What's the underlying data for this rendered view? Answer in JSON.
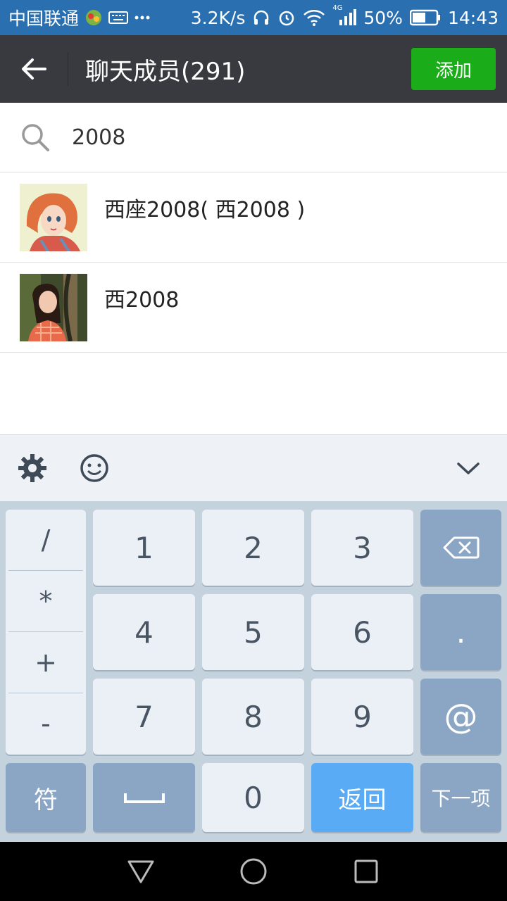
{
  "status_bar": {
    "carrier": "中国联通",
    "speed": "3.2K/s",
    "network": "4G",
    "battery": "50%",
    "time": "14:43",
    "icons": [
      "app-notification-icon",
      "keyboard-icon",
      "more-dots-icon",
      "headphones-icon",
      "alarm-icon",
      "wifi-icon",
      "signal-icon",
      "battery-icon"
    ]
  },
  "header": {
    "title": "聊天成员(291)",
    "add_label": "添加"
  },
  "search": {
    "value": "2008"
  },
  "members": [
    {
      "name": "西座2008( 西2008 )",
      "avatar": "illustrated-girl-avatar"
    },
    {
      "name": "西2008",
      "avatar": "photo-woman-forest-avatar"
    }
  ],
  "keyboard": {
    "toolbar_icons": [
      "gear-icon",
      "emoji-icon",
      "collapse-chevron-icon"
    ],
    "symbols": [
      "/",
      "*",
      "+",
      "-"
    ],
    "digits": [
      "1",
      "2",
      "3",
      "4",
      "5",
      "6",
      "7",
      "8",
      "9",
      "0"
    ],
    "dot": ".",
    "at": "@",
    "sym_label": "符",
    "return_label": "返回",
    "next_label": "下一项"
  },
  "colors": {
    "status_bar": "#2a6fb0",
    "title_bar": "#393a3f",
    "add_button": "#1aad19",
    "keyboard_bg": "#c4d2de",
    "key_dark": "#8aa6c4",
    "key_blue": "#5aabf5"
  }
}
